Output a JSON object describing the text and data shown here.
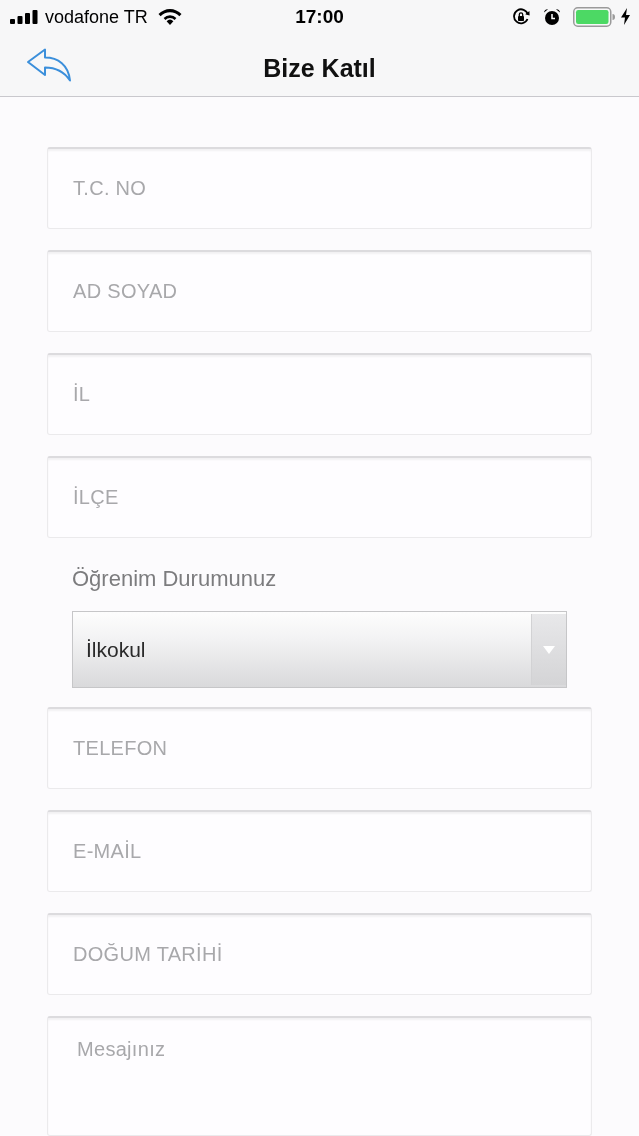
{
  "status_bar": {
    "carrier": "vodafone TR",
    "time": "17:00",
    "charging": true
  },
  "nav": {
    "title": "Bize Katıl"
  },
  "form": {
    "fields": [
      {
        "kind": "input",
        "placeholder": "T.C. NO"
      },
      {
        "kind": "input",
        "placeholder": "AD SOYAD"
      },
      {
        "kind": "input",
        "placeholder": "İL"
      },
      {
        "kind": "input",
        "placeholder": "İLÇE"
      },
      {
        "kind": "select",
        "label": "Öğrenim Durumunuz",
        "value": "İlkokul"
      },
      {
        "kind": "input",
        "placeholder": "TELEFON"
      },
      {
        "kind": "input",
        "placeholder": "E-MAİL"
      },
      {
        "kind": "input",
        "placeholder": "DOĞUM TARİHİ"
      },
      {
        "kind": "textarea",
        "placeholder": "Mesajınız"
      }
    ]
  }
}
